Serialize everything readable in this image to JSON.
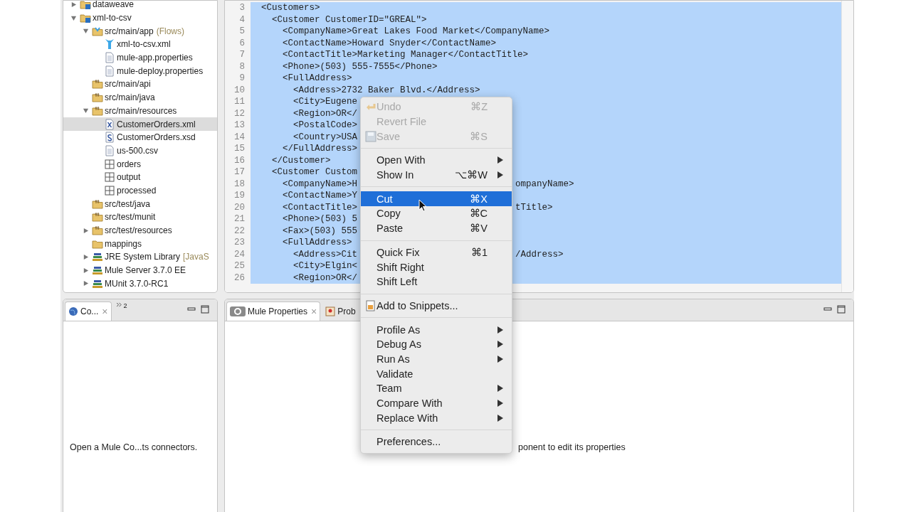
{
  "explorer": {
    "tree": [
      {
        "label": "dataweave",
        "kind": "project",
        "expanded": false,
        "selected": false
      },
      {
        "label": "xml-to-csv",
        "kind": "project",
        "expanded": true,
        "selected": false,
        "children": [
          {
            "label": "src/main/app",
            "decoration": "(Flows)",
            "kind": "source-folder",
            "expanded": true,
            "selected": false,
            "children": [
              {
                "label": "xml-to-csv.xml",
                "kind": "mule-config",
                "selected": false
              },
              {
                "label": "mule-app.properties",
                "kind": "file",
                "selected": false
              },
              {
                "label": "mule-deploy.properties",
                "kind": "file",
                "selected": false
              }
            ]
          },
          {
            "label": "src/main/api",
            "kind": "package-folder",
            "selected": false
          },
          {
            "label": "src/main/java",
            "kind": "package-folder",
            "selected": false
          },
          {
            "label": "src/main/resources",
            "kind": "package-folder",
            "expanded": true,
            "selected": false,
            "children": [
              {
                "label": "CustomerOrders.xml",
                "kind": "xml",
                "selected": true
              },
              {
                "label": "CustomerOrders.xsd",
                "kind": "xsd",
                "selected": false
              },
              {
                "label": "us-500.csv",
                "kind": "file",
                "selected": false
              },
              {
                "label": "orders",
                "kind": "grid-folder",
                "selected": false
              },
              {
                "label": "output",
                "kind": "grid-folder",
                "selected": false
              },
              {
                "label": "processed",
                "kind": "grid-folder",
                "selected": false
              }
            ]
          },
          {
            "label": "src/test/java",
            "kind": "package-folder",
            "selected": false
          },
          {
            "label": "src/test/munit",
            "kind": "package-folder",
            "selected": false
          },
          {
            "label": "src/test/resources",
            "kind": "package-folder",
            "expanded": false,
            "selected": false
          },
          {
            "label": "mappings",
            "kind": "folder",
            "selected": false
          },
          {
            "label": "JRE System Library",
            "decoration": "[JavaS",
            "kind": "library",
            "expanded": false,
            "selected": false
          },
          {
            "label": "Mule Server 3.7.0 EE",
            "kind": "library",
            "expanded": false,
            "selected": false
          },
          {
            "label": "MUnit 3.7.0-RC1",
            "kind": "library",
            "expanded": false,
            "selected": false
          }
        ]
      }
    ]
  },
  "editor": {
    "lines": [
      {
        "number": "3",
        "text": "<Customers>",
        "children": [
          {
            "number": "4",
            "text": "<Customer CustomerID=\"GREAL\">",
            "children": [
              {
                "number": "5",
                "text": "<CompanyName>Great Lakes Food Market</CompanyName>"
              },
              {
                "number": "6",
                "text": "<ContactName>Howard Snyder</ContactName>"
              },
              {
                "number": "7",
                "text": "<ContactTitle>Marketing Manager</ContactTitle>"
              },
              {
                "number": "8",
                "text": "<Phone>(503) 555-7555</Phone>"
              },
              {
                "number": "9",
                "text": "<FullAddress>",
                "children": [
                  {
                    "number": "10",
                    "text": "<Address>2732 Baker Blvd.</Address>"
                  },
                  {
                    "number": "11",
                    "text": "<City>Eugene"
                  },
                  {
                    "number": "12",
                    "text": "<Region>OR</"
                  },
                  {
                    "number": "13",
                    "text": "<PostalCode>"
                  },
                  {
                    "number": "14",
                    "text": "<Country>USA"
                  }
                ]
              },
              {
                "number": "15",
                "text": "</FullAddress>"
              }
            ]
          },
          {
            "number": "16",
            "text": "</Customer>"
          },
          {
            "number": "17",
            "text": "<Customer Custom",
            "children": [
              {
                "number": "18",
                "text": "<CompanyName>H",
                "tail": "ompanyName>"
              },
              {
                "number": "19",
                "text": "<ContactName>Y"
              },
              {
                "number": "20",
                "text": "<ContactTitle>",
                "tail": "tTitle>"
              },
              {
                "number": "21",
                "text": "<Phone>(503) 5"
              },
              {
                "number": "22",
                "text": "<Fax>(503) 555"
              },
              {
                "number": "23",
                "text": "<FullAddress>",
                "children": [
                  {
                    "number": "24",
                    "text": "<Address>Cit",
                    "tail": "/Address>"
                  },
                  {
                    "number": "25",
                    "text": "<City>Elgin<"
                  },
                  {
                    "number": "26",
                    "text": "<Region>OR</"
                  }
                ]
              }
            ]
          }
        ]
      }
    ]
  },
  "connectors_panel": {
    "tabs": [
      {
        "label": "Co...",
        "kind": "view",
        "close": "×",
        "selected": true
      },
      {
        "label": "2",
        "kind": "overflow",
        "selected": false
      }
    ],
    "message": "Open a Mule Co...ts connectors."
  },
  "properties_panel": {
    "tabs": [
      {
        "label": "Mule Properties",
        "kind": "properties",
        "close": "×",
        "selected": true
      },
      {
        "label": "Prob",
        "kind": "problems",
        "selected": false
      }
    ],
    "message": "ponent to edit its properties"
  },
  "context_menu": {
    "items": [
      {
        "kind": "undo",
        "label": "Undo",
        "shortcut": "⌘Z",
        "disabled": true,
        "selected": false
      },
      {
        "kind": "item",
        "label": "Revert File",
        "disabled": true,
        "selected": false
      },
      {
        "kind": "save",
        "label": "Save",
        "shortcut": "⌘S",
        "disabled": true,
        "selected": false
      },
      {
        "kind": "separator"
      },
      {
        "kind": "item",
        "label": "Open With",
        "submenu": true,
        "disabled": false,
        "selected": false
      },
      {
        "kind": "item",
        "label": "Show In",
        "shortcut": "⌥⌘W",
        "submenu": true,
        "disabled": false,
        "selected": false
      },
      {
        "kind": "separator"
      },
      {
        "kind": "item",
        "label": "Cut",
        "shortcut": "⌘X",
        "disabled": false,
        "selected": true
      },
      {
        "kind": "item",
        "label": "Copy",
        "shortcut": "⌘C",
        "disabled": false,
        "selected": false
      },
      {
        "kind": "item",
        "label": "Paste",
        "shortcut": "⌘V",
        "disabled": false,
        "selected": false
      },
      {
        "kind": "separator"
      },
      {
        "kind": "item",
        "label": "Quick Fix",
        "shortcut": "⌘1",
        "disabled": false,
        "selected": false
      },
      {
        "kind": "item",
        "label": "Shift Right",
        "disabled": false,
        "selected": false
      },
      {
        "kind": "item",
        "label": "Shift Left",
        "disabled": false,
        "selected": false
      },
      {
        "kind": "separator"
      },
      {
        "kind": "snippets",
        "label": "Add to Snippets...",
        "disabled": false,
        "selected": false
      },
      {
        "kind": "separator"
      },
      {
        "kind": "item",
        "label": "Profile As",
        "submenu": true,
        "disabled": false,
        "selected": false
      },
      {
        "kind": "item",
        "label": "Debug As",
        "submenu": true,
        "disabled": false,
        "selected": false
      },
      {
        "kind": "item",
        "label": "Run As",
        "submenu": true,
        "disabled": false,
        "selected": false
      },
      {
        "kind": "item",
        "label": "Validate",
        "disabled": false,
        "selected": false
      },
      {
        "kind": "item",
        "label": "Team",
        "submenu": true,
        "disabled": false,
        "selected": false
      },
      {
        "kind": "item",
        "label": "Compare With",
        "submenu": true,
        "disabled": false,
        "selected": false
      },
      {
        "kind": "item",
        "label": "Replace With",
        "submenu": true,
        "disabled": false,
        "selected": false
      },
      {
        "kind": "separator"
      },
      {
        "kind": "item",
        "label": "Preferences...",
        "disabled": false,
        "selected": false
      }
    ]
  }
}
